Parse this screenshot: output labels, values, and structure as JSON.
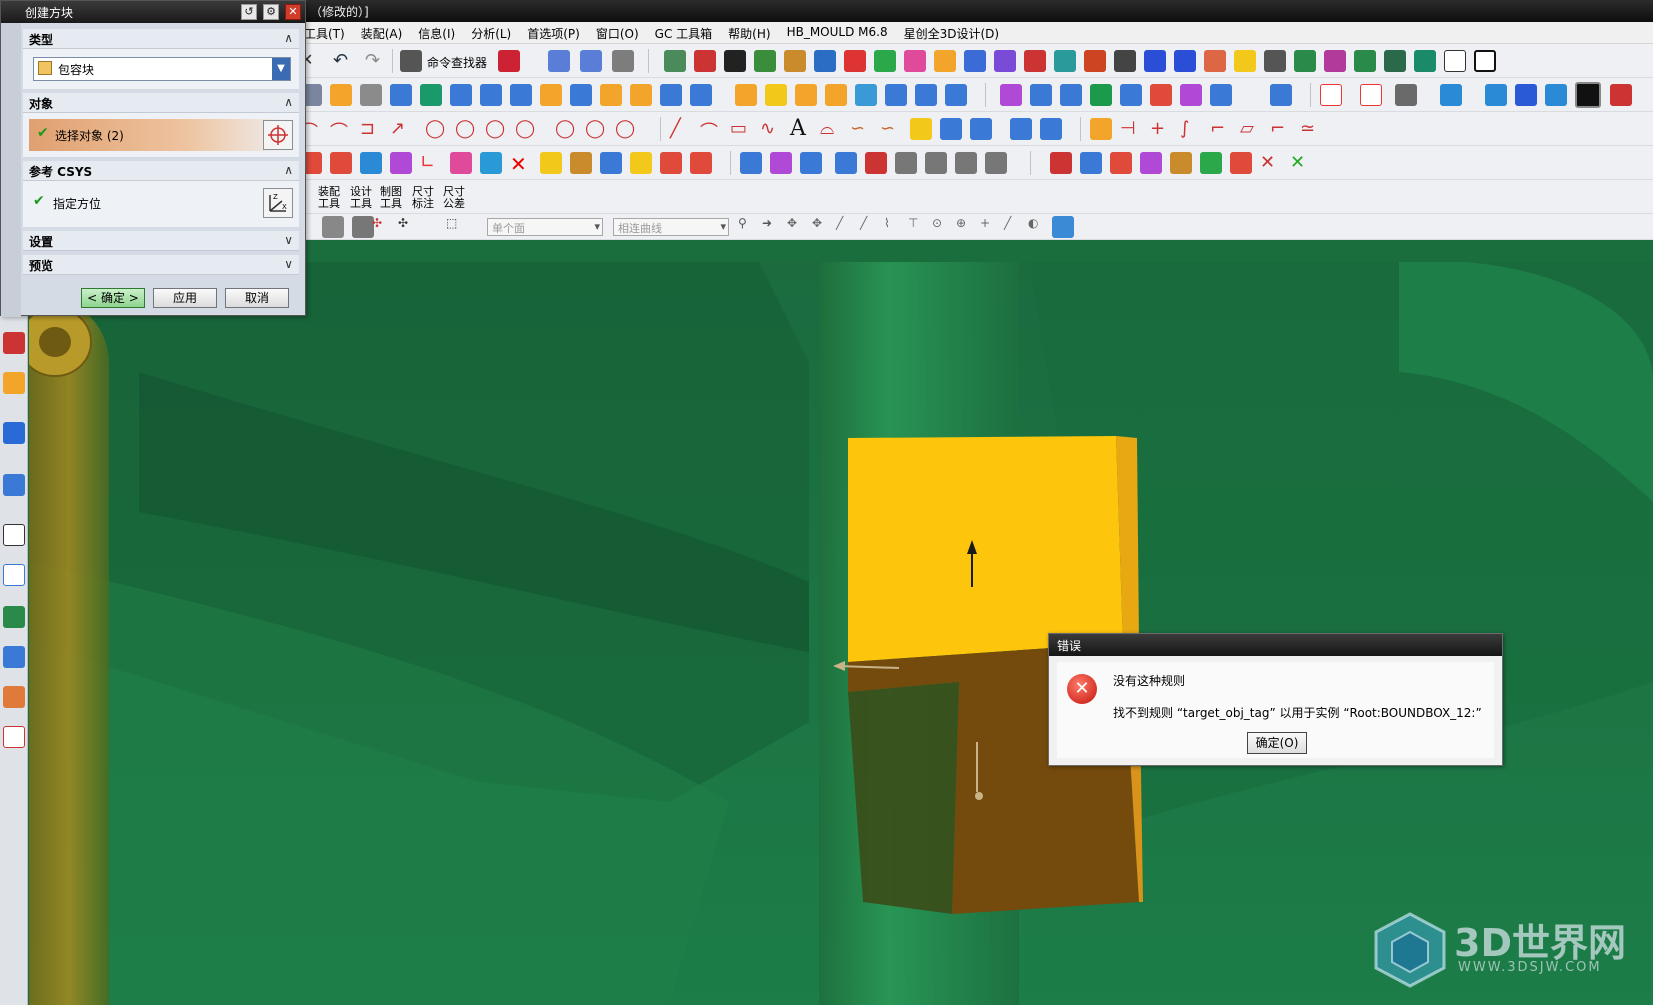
{
  "window": {
    "title_suffix": "（修改的）]"
  },
  "menubar": {
    "items": [
      "工具(T)",
      "装配(A)",
      "信息(I)",
      "分析(L)",
      "首选项(P)",
      "窗口(O)",
      "GC 工具箱",
      "帮助(H)",
      "HB_MOULD M6.8",
      "星创全3D设计(D)"
    ]
  },
  "toolbar": {
    "command_finder": "命令查找器",
    "face_filter": "单个面",
    "curve_filter": "相连曲线",
    "labels2": [
      [
        "装配",
        "工具"
      ],
      [
        "设计",
        "工具"
      ],
      [
        "制图",
        "工具"
      ],
      [
        "尺寸",
        "标注"
      ],
      [
        "尺寸",
        "公差"
      ]
    ]
  },
  "block_dialog": {
    "title": "创建方块",
    "sections": {
      "type": "类型",
      "object": "对象",
      "ref_csys": "参考 CSYS",
      "settings": "设置",
      "preview": "预览"
    },
    "type_value": "包容块",
    "select_object": "选择对象 (2)",
    "specify_orientation": "指定方位",
    "buttons": {
      "ok": "< 确定 >",
      "apply": "应用",
      "cancel": "取消"
    }
  },
  "error_dialog": {
    "title": "错误",
    "message1": "没有这种规则",
    "message2": "找不到规则 “target_obj_tag” 以用于实例 “Root:BOUNDBOX_12:”",
    "ok": "确定(O)"
  },
  "watermark": {
    "logo": "3D世界网",
    "url": "WWW.3DSJW.COM"
  },
  "colors": {
    "viewport": "#1d7a45",
    "block_top": "#fdc60c",
    "block_bottom": "#744a0d",
    "accent_orange": "#e0a070"
  }
}
